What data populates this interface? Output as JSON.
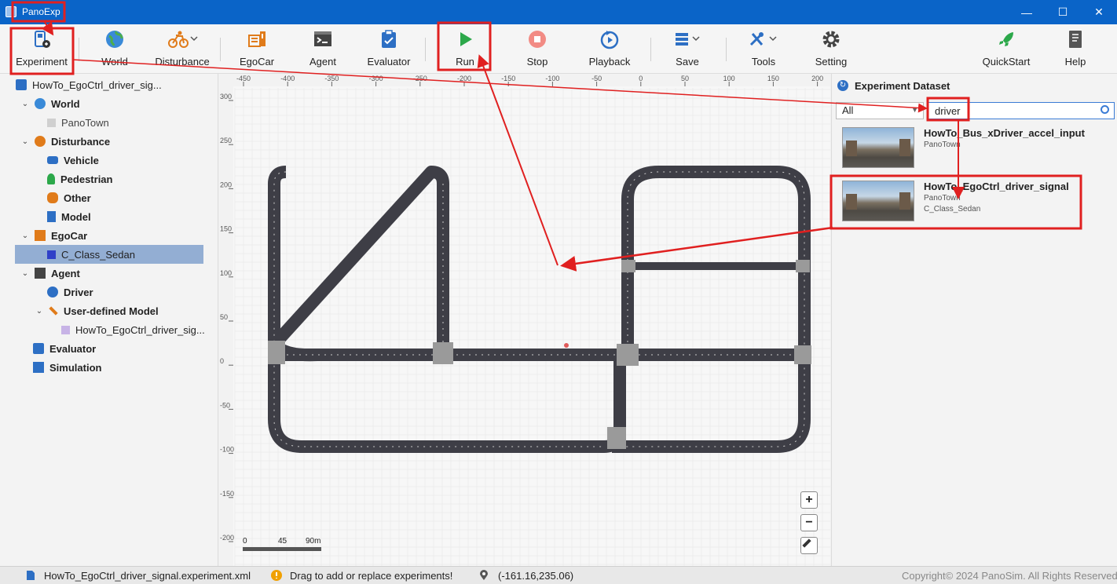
{
  "window": {
    "title": "PanoExp",
    "minimize": "—",
    "maximize": "☐",
    "close": "✕"
  },
  "toolbar": {
    "experiment": "Experiment",
    "world": "World",
    "disturbance": "Disturbance",
    "egocar": "EgoCar",
    "agent": "Agent",
    "evaluator": "Evaluator",
    "run": "Run",
    "stop": "Stop",
    "playback": "Playback",
    "save": "Save",
    "tools": "Tools",
    "setting": "Setting",
    "quickstart": "QuickStart",
    "help": "Help"
  },
  "tree": {
    "root": "HowTo_EgoCtrl_driver_sig...",
    "world": "World",
    "panotown": "PanoTown",
    "disturbance": "Disturbance",
    "vehicle": "Vehicle",
    "pedestrian": "Pedestrian",
    "other": "Other",
    "model": "Model",
    "egocar": "EgoCar",
    "egocar_item": "C_Class_Sedan",
    "agent": "Agent",
    "driver": "Driver",
    "user_model": "User-defined Model",
    "user_model_item": "HowTo_EgoCtrl_driver_sig...",
    "evaluator": "Evaluator",
    "simulation": "Simulation"
  },
  "canvas": {
    "x_ticks": [
      "-450",
      "-400",
      "-350",
      "-300",
      "-250",
      "-200",
      "-150",
      "-100",
      "-50",
      "0",
      "50",
      "100",
      "150",
      "200"
    ],
    "y_ticks": [
      "300",
      "250",
      "200",
      "150",
      "100",
      "50",
      "0",
      "-50",
      "-100",
      "-150",
      "-200"
    ],
    "scale_labels": [
      "0",
      "45",
      "90m"
    ],
    "zoom_in": "+",
    "zoom_out": "−"
  },
  "panel": {
    "title": "Experiment Dataset",
    "filter": "All",
    "search_value": "driver",
    "items": [
      {
        "name": "HowTo_Bus_xDriver_accel_input",
        "map": "PanoTown",
        "vehicle": ""
      },
      {
        "name": "HowTo_EgoCtrl_driver_signal",
        "map": "PanoTown",
        "vehicle": "C_Class_Sedan"
      }
    ]
  },
  "status": {
    "file": "HowTo_EgoCtrl_driver_signal.experiment.xml",
    "hint": "Drag to add or replace experiments!",
    "coords": "(-161.16,235.06)",
    "copyright": "Copyright© 2024 PanoSim. All Rights Reserved"
  },
  "colors": {
    "titlebar": "#0a64c8",
    "annotation": "#e02020",
    "road": "#3e3e46",
    "selection": "#93aed3"
  }
}
